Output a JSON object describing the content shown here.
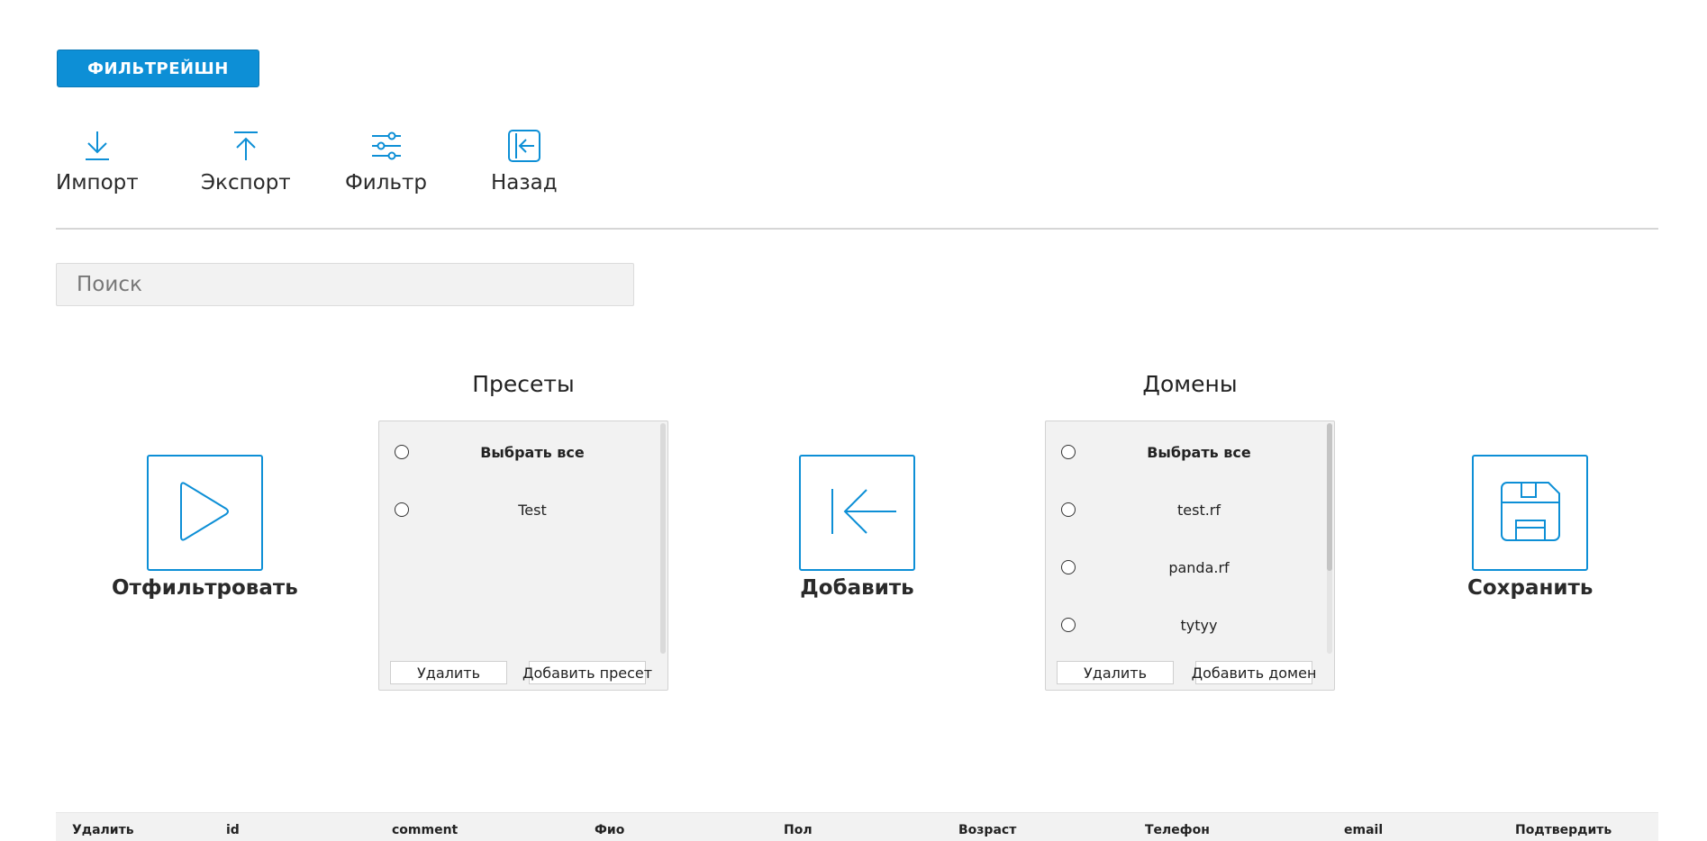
{
  "brand": {
    "label": "ФИЛЬТРЕЙШН",
    "color": "#0d8fd6"
  },
  "toolbar": {
    "import_label": "Импорт",
    "export_label": "Экспорт",
    "filter_label": "Фильтр",
    "back_label": "Назад"
  },
  "search": {
    "placeholder": "Поиск",
    "value": ""
  },
  "actions": {
    "filter_label": "Отфильтровать",
    "add_label": "Добавить",
    "save_label": "Сохранить"
  },
  "presets": {
    "title": "Пресеты",
    "select_all": "Выбрать все",
    "items": [
      "Test"
    ],
    "delete_label": "Удалить",
    "add_label": "Добавить пресет"
  },
  "domains": {
    "title": "Домены",
    "select_all": "Выбрать все",
    "items": [
      "test.rf",
      "panda.rf",
      "tytyy"
    ],
    "delete_label": "Удалить",
    "add_label": "Добавить домен"
  },
  "table": {
    "columns": [
      "Удалить",
      "id",
      "comment",
      "Фио",
      "Пол",
      "Возраст",
      "Телефон",
      "email",
      "Подтвердить"
    ]
  },
  "accent_color": "#0d8fd6",
  "icons": {
    "import": "download-icon",
    "export": "upload-icon",
    "filter": "sliders-icon",
    "back": "back-arrow-icon",
    "run": "play-icon",
    "add": "arrow-left-bar-icon",
    "save": "floppy-disk-icon"
  }
}
